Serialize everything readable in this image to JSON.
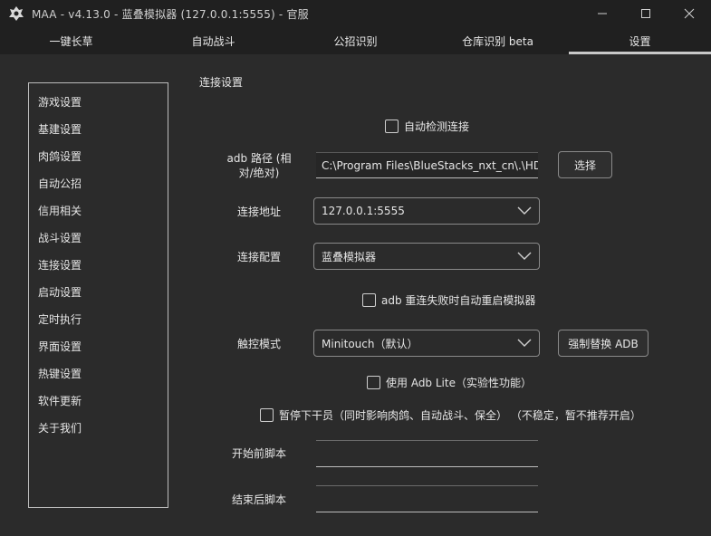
{
  "window": {
    "title": "MAA - v4.13.0 - 蓝叠模拟器 (127.0.0.1:5555) - 官服"
  },
  "tabs": [
    "一键长草",
    "自动战斗",
    "公招识别",
    "仓库识别 beta",
    "设置"
  ],
  "sidebar": {
    "items": [
      "游戏设置",
      "基建设置",
      "肉鸽设置",
      "自动公招",
      "信用相关",
      "战斗设置",
      "连接设置",
      "启动设置",
      "定时执行",
      "界面设置",
      "热键设置",
      "软件更新",
      "关于我们"
    ]
  },
  "connection": {
    "section_title": "连接设置",
    "auto_detect_label": "自动检测连接",
    "adb_path_label": "adb 路径 (相对/绝对)",
    "adb_path_value": "C:\\Program Files\\BlueStacks_nxt_cn\\.\\HD",
    "select_button": "选择",
    "address_label": "连接地址",
    "address_value": "127.0.0.1:5555",
    "config_label": "连接配置",
    "config_value": "蓝叠模拟器",
    "restart_emulator_label": "adb 重连失败时自动重启模拟器",
    "touch_mode_label": "触控模式",
    "touch_mode_value": "Minitouch（默认）",
    "force_replace_adb_button": "强制替换 ADB",
    "adb_lite_label": "使用 Adb Lite（实验性功能）",
    "pause_operator_label": "暂停下干员（同时影响肉鸽、自动战斗、保全） （不稳定，暂不推荐开启）",
    "pre_script_label": "开始前脚本",
    "post_script_label": "结束后脚本"
  }
}
